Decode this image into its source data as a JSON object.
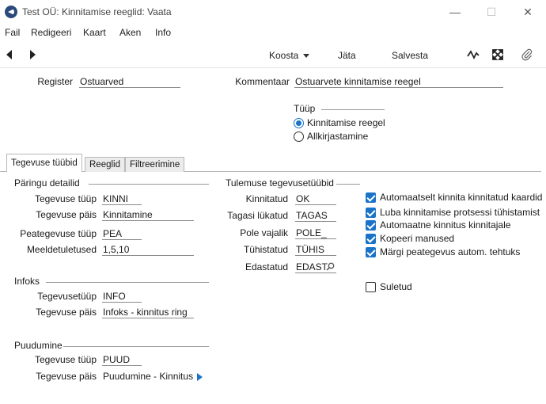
{
  "window": {
    "title": "Test OÜ: Kinnitamise reeglid: Vaata",
    "minimize_icon": "—",
    "maximize_icon": "☐",
    "close_icon": "✕"
  },
  "menu": [
    "Fail",
    "Redigeeri",
    "Kaart",
    "Aken",
    "Info"
  ],
  "toolbar": {
    "create_label": "Koosta",
    "skip_label": "Jäta",
    "save_label": "Salvesta",
    "icons": [
      "back-arrow-icon",
      "forward-arrow-icon",
      "activity-icon",
      "expand-icon",
      "paperclip-icon"
    ]
  },
  "header": {
    "register_label": "Register",
    "register_value": "Ostuarved",
    "comment_label": "Kommentaar",
    "comment_value": "Ostuarvete kinnitamise reegel",
    "type_label": "Tüüp",
    "type_options": [
      "Kinnitamise reegel",
      "Allkirjastamine"
    ],
    "type_selected": "Kinnitamise reegel"
  },
  "tabs": [
    "Tegevuse tüübid",
    "Reeglid",
    "Filtreerimine"
  ],
  "active_tab": "Tegevuse tüübid",
  "query": {
    "title": "Päringu detailid",
    "rows": [
      {
        "label": "Tegevuse tüüp",
        "value": "KINNI"
      },
      {
        "label": "Tegevuse päis",
        "value": "Kinnitamine"
      },
      {
        "label": "Peategevuse tüüp",
        "value": "PEA"
      },
      {
        "label": "Meeldetuletused",
        "value": "1,5,10"
      }
    ]
  },
  "infos": {
    "title": "Infoks",
    "rows": [
      {
        "label": "Tegevusetüüp",
        "value": "INFO"
      },
      {
        "label": "Tegevuse päis",
        "value": "Infoks - kinnitus ring"
      }
    ]
  },
  "missing": {
    "title": "Puudumine",
    "rows": [
      {
        "label": "Tegevuse tüüp",
        "value": "PUUD"
      },
      {
        "label": "Tegevuse päis",
        "value": "Puudumine - Kinnitus"
      }
    ]
  },
  "results": {
    "title": "Tulemuse tegevusetüübid",
    "rows": [
      {
        "label": "Kinnitatud",
        "value": "OK"
      },
      {
        "label": "Tagasi lükatud",
        "value": "TAGAS"
      },
      {
        "label": "Pole vajalik",
        "value": "POLE_"
      },
      {
        "label": "Tühistatud",
        "value": "TÜHIS"
      },
      {
        "label": "Edastatud",
        "value": "EDAST"
      }
    ]
  },
  "options": [
    {
      "label": "Automaatselt kinnita kinnitatud kaardid",
      "checked": true
    },
    {
      "label": "Luba kinnitamise protsessi tühistamist",
      "checked": true
    },
    {
      "label": "Automaatne kinnitus kinnitajale",
      "checked": true
    },
    {
      "label": "Kopeeri manused",
      "checked": true
    },
    {
      "label": "Märgi peategevus autom. tehtuks",
      "checked": true
    }
  ],
  "closed": {
    "label": "Suletud",
    "checked": false
  },
  "colors": {
    "accent": "#1a73c9"
  }
}
